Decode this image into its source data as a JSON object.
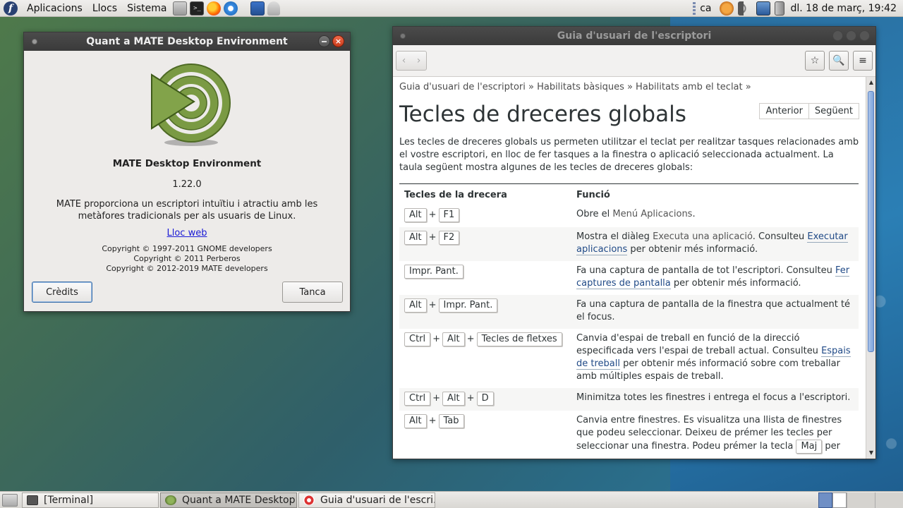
{
  "top_panel": {
    "menus": [
      "Aplicacions",
      "Llocs",
      "Sistema"
    ],
    "keyboard_layout": "ca",
    "clock": "dl. 18 de març, 19:42"
  },
  "about": {
    "title": "Quant a MATE Desktop Environment",
    "name": "MATE Desktop Environment",
    "version": "1.22.0",
    "description_line1": "MATE proporciona un escriptori intuïtiu i atractiu amb les",
    "description_line2": "metàfores tradicionals per als usuaris de Linux.",
    "website_link": "Lloc web",
    "copyright": [
      "Copyright © 1997-2011 GNOME developers",
      "Copyright © 2011 Perberos",
      "Copyright © 2012-2019 MATE developers"
    ],
    "credits_button": "Crèdits",
    "close_button": "Tanca"
  },
  "help": {
    "title": "Guia d'usuari de l'escriptori",
    "breadcrumb": "Guia d'usuari de l'escriptori » Habilitats bàsiques » Habilitats amb el teclat »",
    "page_title": "Tecles de dreceres globals",
    "prev": "Anterior",
    "next": "Següent",
    "intro": "Les tecles de dreceres globals us permeten utilitzar el teclat per realitzar tasques relacionades amb el vostre escriptori, en lloc de fer tasques a la finestra o aplicació seleccionada actualment. La taula següent mostra algunes de les tecles de dreceres globals:",
    "col_keys": "Tecles de la drecera",
    "col_function": "Funció",
    "rows": [
      {
        "keys": [
          "Alt",
          "F1"
        ],
        "pre": "Obre el ",
        "gui": "Menú Aplicacions",
        "mid": ".",
        "link": "",
        "post": ""
      },
      {
        "keys": [
          "Alt",
          "F2"
        ],
        "pre": "Mostra el diàleg ",
        "gui": "Executa una aplicació",
        "mid": ". Consulteu ",
        "link": "Executar aplicacions",
        "post": " per obtenir més informació."
      },
      {
        "keys": [
          "Impr. Pant."
        ],
        "pre": "Fa una captura de pantalla de tot l'escriptori. Consulteu ",
        "gui": "",
        "mid": "",
        "link": "Fer captures de pantalla",
        "post": " per obtenir més informació."
      },
      {
        "keys": [
          "Alt",
          "Impr. Pant."
        ],
        "pre": "Fa una captura de pantalla de la finestra que actualment té el focus.",
        "gui": "",
        "mid": "",
        "link": "",
        "post": ""
      },
      {
        "keys": [
          "Ctrl",
          "Alt",
          "Tecles de fletxes"
        ],
        "pre": "Canvia d'espai de treball en funció de la direcció especificada vers l'espai de treball actual. Consulteu ",
        "gui": "",
        "mid": "",
        "link": "Espais de treball",
        "post": " per obtenir més informació sobre com treballar amb múltiples espais de treball."
      },
      {
        "keys": [
          "Ctrl",
          "Alt",
          "D"
        ],
        "pre": "Minimitza totes les finestres i entrega el focus a l'escriptori.",
        "gui": "",
        "mid": "",
        "link": "",
        "post": ""
      },
      {
        "keys": [
          "Alt",
          "Tab"
        ],
        "pre": "Canvia entre finestres. Es visualitza una llista de finestres que podeu seleccionar. Deixeu de prémer les tecles per seleccionar una finestra. Podeu prémer la tecla ",
        "gui": "",
        "mid": "",
        "link": "",
        "post": "",
        "kbd_inline": "Maj",
        "tail": " per"
      }
    ]
  },
  "taskbar": {
    "tasks": [
      "[Terminal]",
      "Quant a MATE Desktop...",
      "Guia d'usuari de l'escri..."
    ]
  }
}
